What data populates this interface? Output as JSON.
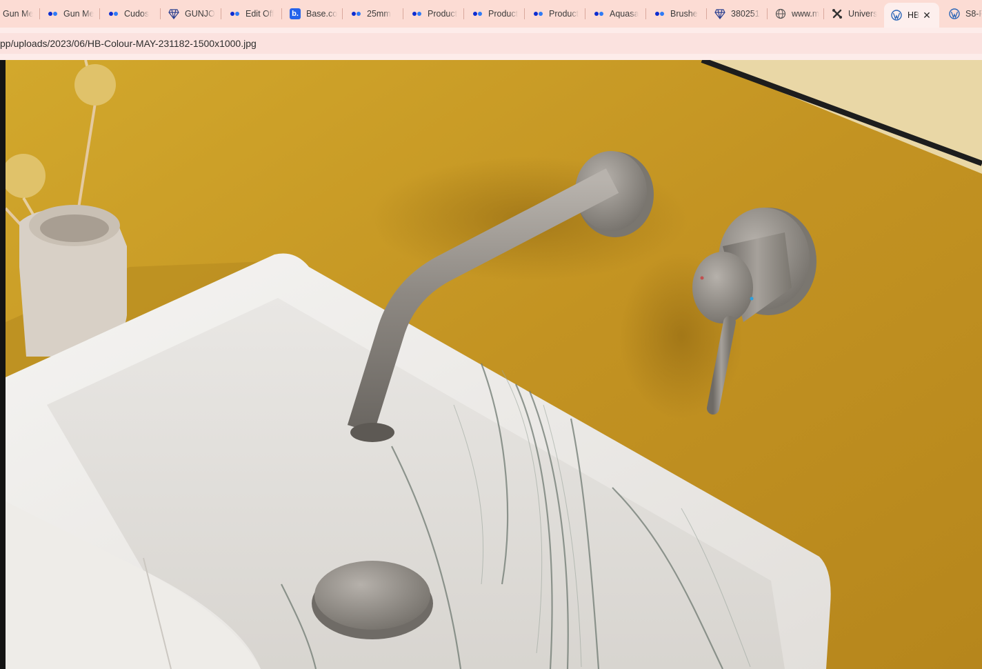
{
  "browser": {
    "tabs": [
      {
        "title": "Gun Me",
        "icon": "none"
      },
      {
        "title": "Gun Me",
        "icon": "dots-icon"
      },
      {
        "title": "Cudos",
        "icon": "dots-icon"
      },
      {
        "title": "GUNJO",
        "icon": "diamond-icon"
      },
      {
        "title": "Edit Off",
        "icon": "dots-icon"
      },
      {
        "title": "Base.co",
        "icon": "b-icon"
      },
      {
        "title": "25mm",
        "icon": "dots-icon"
      },
      {
        "title": "Product",
        "icon": "dots-icon"
      },
      {
        "title": "Product",
        "icon": "dots-icon"
      },
      {
        "title": "Product",
        "icon": "dots-icon"
      },
      {
        "title": "Aquasa",
        "icon": "dots-icon"
      },
      {
        "title": "Brushe",
        "icon": "dots-icon"
      },
      {
        "title": "380251",
        "icon": "diamond-icon"
      },
      {
        "title": "www.m",
        "icon": "globe-icon"
      },
      {
        "title": "Univers",
        "icon": "cross-icon"
      },
      {
        "title": "HB",
        "icon": "wordpress-icon",
        "active": true
      },
      {
        "title": "S8-F",
        "icon": "wordpress-icon"
      }
    ],
    "close_glyph": "✕",
    "b_glyph": "b.",
    "address": "pp/uploads/2023/06/HB-Colour-MAY-231182-1500x1000.jpg"
  },
  "image": {
    "subject": "brushed nickel wall-mounted basin tap above marble basin",
    "colors": {
      "wall": "#c49622",
      "metal": "#8f8a84",
      "marble": "#f1efec",
      "vein": "#6f7a72"
    }
  }
}
